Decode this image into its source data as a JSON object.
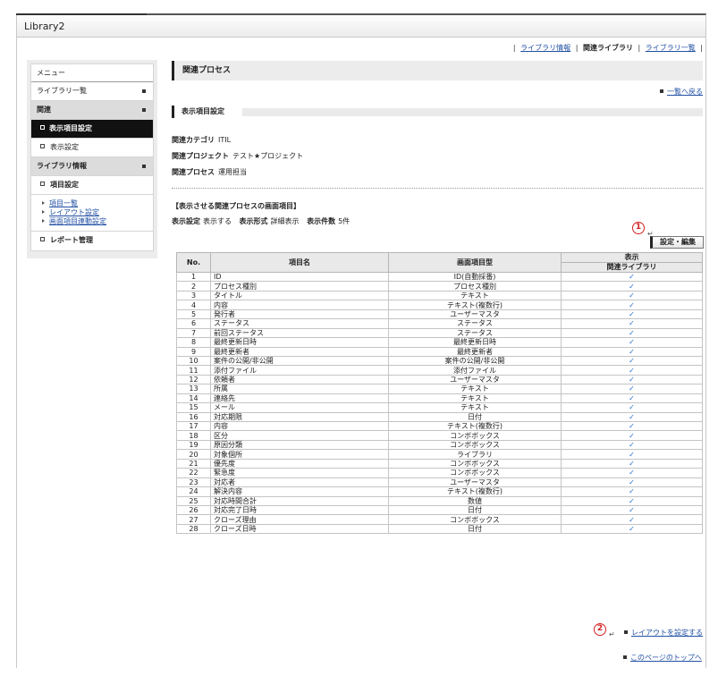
{
  "app": {
    "title": "Library2"
  },
  "topnav": {
    "library_info": "ライブラリ情報",
    "related_library": "関連ライブラリ",
    "library_list": "ライブラリ一覧"
  },
  "sidebar": {
    "menu": "メニュー",
    "library_list": "ライブラリ一覧",
    "related": "関連",
    "display_items": "表示項目設定",
    "display_settings": "表示設定",
    "library_info": "ライブラリ情報",
    "item_settings": "項目設定",
    "links": [
      "項目一覧",
      "レイアウト設定",
      "画面項目連動設定"
    ],
    "report": "レポート管理"
  },
  "main": {
    "page_title": "関連プロセス",
    "back_link": "一覧へ戻る",
    "section_title": "表示項目設定",
    "category_label": "関連カテゴリ",
    "category_value": "ITIL",
    "project_label": "関連プロジェクト",
    "project_value": "テスト★プロジェクト",
    "process_label": "関連プロセス",
    "process_value": "運用担当",
    "subhead": "【表示させる関連プロセスの画面項目】",
    "setting_label": "表示設定",
    "setting_value": "表示する",
    "format_label": "表示形式",
    "format_value": "詳細表示",
    "count_label": "表示件数",
    "count_value": "5件",
    "marker1": "1",
    "marker2": "2",
    "return_mark": "↵",
    "edit_button": "設定・編集",
    "layout_link": "レイアウトを設定する",
    "top_link": "このページのトップへ"
  },
  "table": {
    "headers": {
      "no": "No.",
      "name": "項目名",
      "type": "画面項目型",
      "display": "表示",
      "display_sub": "関連ライブラリ"
    },
    "check": "✓",
    "rows": [
      {
        "no": "1",
        "name": "ID",
        "type": "ID(自動採番)"
      },
      {
        "no": "2",
        "name": "プロセス種別",
        "type": "プロセス種別"
      },
      {
        "no": "3",
        "name": "タイトル",
        "type": "テキスト"
      },
      {
        "no": "4",
        "name": "内容",
        "type": "テキスト(複数行)"
      },
      {
        "no": "5",
        "name": "発行者",
        "type": "ユーザーマスタ"
      },
      {
        "no": "6",
        "name": "ステータス",
        "type": "ステータス"
      },
      {
        "no": "7",
        "name": "前回ステータス",
        "type": "ステータス"
      },
      {
        "no": "8",
        "name": "最終更新日時",
        "type": "最終更新日時"
      },
      {
        "no": "9",
        "name": "最終更新者",
        "type": "最終更新者"
      },
      {
        "no": "10",
        "name": "案件の公開/非公開",
        "type": "案件の公開/非公開"
      },
      {
        "no": "11",
        "name": "添付ファイル",
        "type": "添付ファイル"
      },
      {
        "no": "12",
        "name": "依頼者",
        "type": "ユーザーマスタ"
      },
      {
        "no": "13",
        "name": "所属",
        "type": "テキスト"
      },
      {
        "no": "14",
        "name": "連絡先",
        "type": "テキスト"
      },
      {
        "no": "15",
        "name": "メール",
        "type": "テキスト"
      },
      {
        "no": "16",
        "name": "対応期限",
        "type": "日付"
      },
      {
        "no": "17",
        "name": "内容",
        "type": "テキスト(複数行)"
      },
      {
        "no": "18",
        "name": "区分",
        "type": "コンボボックス"
      },
      {
        "no": "19",
        "name": "原因分類",
        "type": "コンボボックス"
      },
      {
        "no": "20",
        "name": "対象個所",
        "type": "ライブラリ"
      },
      {
        "no": "21",
        "name": "優先度",
        "type": "コンボボックス"
      },
      {
        "no": "22",
        "name": "緊急度",
        "type": "コンボボックス"
      },
      {
        "no": "23",
        "name": "対応者",
        "type": "ユーザーマスタ"
      },
      {
        "no": "24",
        "name": "解決内容",
        "type": "テキスト(複数行)"
      },
      {
        "no": "25",
        "name": "対応時間合計",
        "type": "数値"
      },
      {
        "no": "26",
        "name": "対応完了日時",
        "type": "日付"
      },
      {
        "no": "27",
        "name": "クローズ理由",
        "type": "コンボボックス"
      },
      {
        "no": "28",
        "name": "クローズ日時",
        "type": "日付"
      }
    ]
  }
}
